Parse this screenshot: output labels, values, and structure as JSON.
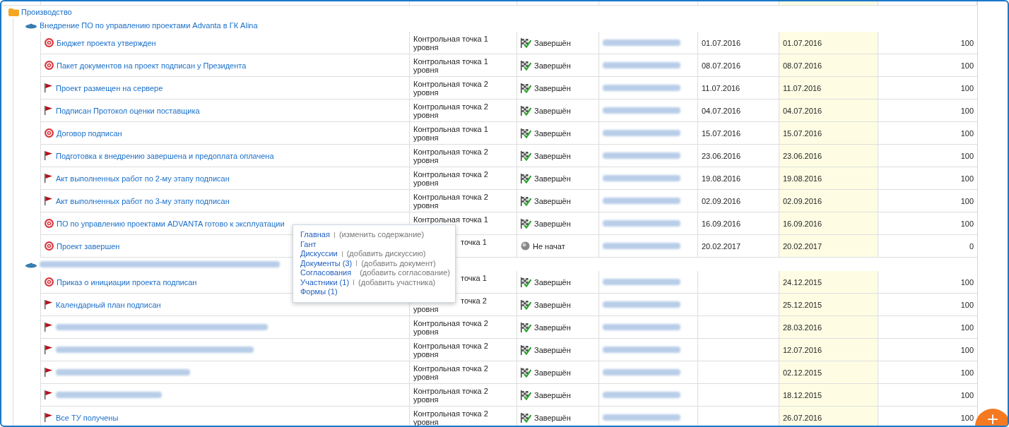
{
  "folder": {
    "name": "Производство",
    "children": [
      {
        "name": "Внедрение ПО по управлению проектами Advanta в ГК Alina",
        "name_hidden": false,
        "children": [
          {
            "kind": "target",
            "name": "Бюджет проекта утвержден",
            "type_lines": [
              "Контрольная точка 1",
              "уровня"
            ],
            "completed": true,
            "status": "Завершён",
            "plan_date": "01.07.2016",
            "fact_date": "01.07.2016",
            "percent": "100"
          },
          {
            "kind": "target",
            "name": "Пакет документов на проект подписан у Президента",
            "type_lines": [
              "Контрольная точка 1",
              "уровня"
            ],
            "completed": true,
            "status": "Завершён",
            "plan_date": "08.07.2016",
            "fact_date": "08.07.2016",
            "percent": "100"
          },
          {
            "kind": "flag",
            "name": "Проект размещен на сервере",
            "type_lines": [
              "Контрольная точка 2",
              "уровня"
            ],
            "completed": true,
            "status": "Завершён",
            "plan_date": "11.07.2016",
            "fact_date": "11.07.2016",
            "percent": "100"
          },
          {
            "kind": "flag",
            "name": "Подписан Протокол оценки поставщика",
            "type_lines": [
              "Контрольная точка 2",
              "уровня"
            ],
            "completed": true,
            "status": "Завершён",
            "plan_date": "04.07.2016",
            "fact_date": "04.07.2016",
            "percent": "100"
          },
          {
            "kind": "target",
            "name": "Договор подписан",
            "type_lines": [
              "Контрольная точка 1",
              "уровня"
            ],
            "completed": true,
            "status": "Завершён",
            "plan_date": "15.07.2016",
            "fact_date": "15.07.2016",
            "percent": "100"
          },
          {
            "kind": "flag",
            "name": "Подготовка к внедрению завершена и предоплата оплачена",
            "type_lines": [
              "Контрольная точка 2",
              "уровня"
            ],
            "completed": true,
            "status": "Завершён",
            "plan_date": "23.06.2016",
            "fact_date": "23.06.2016",
            "percent": "100"
          },
          {
            "kind": "flag",
            "name": "Акт выполненных работ по 2-му этапу подписан",
            "type_lines": [
              "Контрольная точка 2",
              "уровня"
            ],
            "completed": true,
            "status": "Завершён",
            "plan_date": "19.08.2016",
            "fact_date": "19.08.2016",
            "percent": "100"
          },
          {
            "kind": "flag",
            "name": "Акт выполненных работ по 3-му этапу подписан",
            "type_lines": [
              "Контрольная точка 2",
              "уровня"
            ],
            "completed": true,
            "status": "Завершён",
            "plan_date": "02.09.2016",
            "fact_date": "02.09.2016",
            "percent": "100"
          },
          {
            "kind": "target",
            "name": "ПО по управлению проектами ADVANTA готово к эксплуатации",
            "type_lines": [
              "Контрольная точка 1"
            ],
            "completed": true,
            "status": "Завершён",
            "plan_date": "16.09.2016",
            "fact_date": "16.09.2016",
            "percent": "100"
          },
          {
            "kind": "target",
            "name": "Проект завершен",
            "type_lines": [
              "точка 1"
            ],
            "type_tail": true,
            "completed": false,
            "status": "Не начат",
            "plan_date": "20.02.2017",
            "fact_date": "20.02.2017",
            "percent": "0"
          }
        ]
      },
      {
        "name_hidden": true,
        "children": [
          {
            "kind": "target",
            "name": "Приказ о инициации проекта подписан",
            "type_lines": [
              "точка 1"
            ],
            "type_tail": true,
            "completed": true,
            "status": "Завершён",
            "fact_date": "24.12.2015",
            "percent": "100"
          },
          {
            "kind": "flag",
            "name": "Календарный план подписан",
            "type_lines": [
              "точка 2",
              "уровня"
            ],
            "type_tail": true,
            "completed": true,
            "status": "Завершён",
            "fact_date": "25.12.2015",
            "percent": "100"
          },
          {
            "kind": "flag",
            "name_hidden": true,
            "type_lines": [
              "Контрольная точка 2",
              "уровня"
            ],
            "completed": true,
            "status": "Завершён",
            "fact_date": "28.03.2016",
            "percent": "100"
          },
          {
            "kind": "flag",
            "name_hidden": true,
            "type_lines": [
              "Контрольная точка 2",
              "уровня"
            ],
            "completed": true,
            "status": "Завершён",
            "fact_date": "12.07.2016",
            "percent": "100"
          },
          {
            "kind": "flag",
            "name_hidden": true,
            "type_lines": [
              "Контрольная точка 2",
              "уровня"
            ],
            "completed": true,
            "status": "Завершён",
            "fact_date": "02.12.2015",
            "percent": "100"
          },
          {
            "kind": "flag",
            "name_hidden": true,
            "type_lines": [
              "Контрольная точка 2",
              "уровня"
            ],
            "completed": true,
            "status": "Завершён",
            "fact_date": "18.12.2015",
            "percent": "100"
          },
          {
            "kind": "flag",
            "name": "Все ТУ получены",
            "type_lines": [
              "Контрольная точка 2",
              "уровня"
            ],
            "completed": true,
            "status": "Завершён",
            "fact_date": "26.07.2016",
            "percent": "100"
          }
        ]
      }
    ]
  },
  "popup_menu": [
    {
      "link": "Главная",
      "action": "(изменить содержание)"
    },
    {
      "link": "Гант"
    },
    {
      "link": "Дискуссии",
      "action": "(добавить дискуссию)"
    },
    {
      "link": "Документы (3)",
      "action": "(добавить документ)"
    },
    {
      "link": "Согласования",
      "action": "(добавить согласование)"
    },
    {
      "link": "Участники (1)",
      "action": "(добавить участника)"
    },
    {
      "link": "Формы (1)"
    }
  ],
  "fab": {
    "label": "+"
  }
}
